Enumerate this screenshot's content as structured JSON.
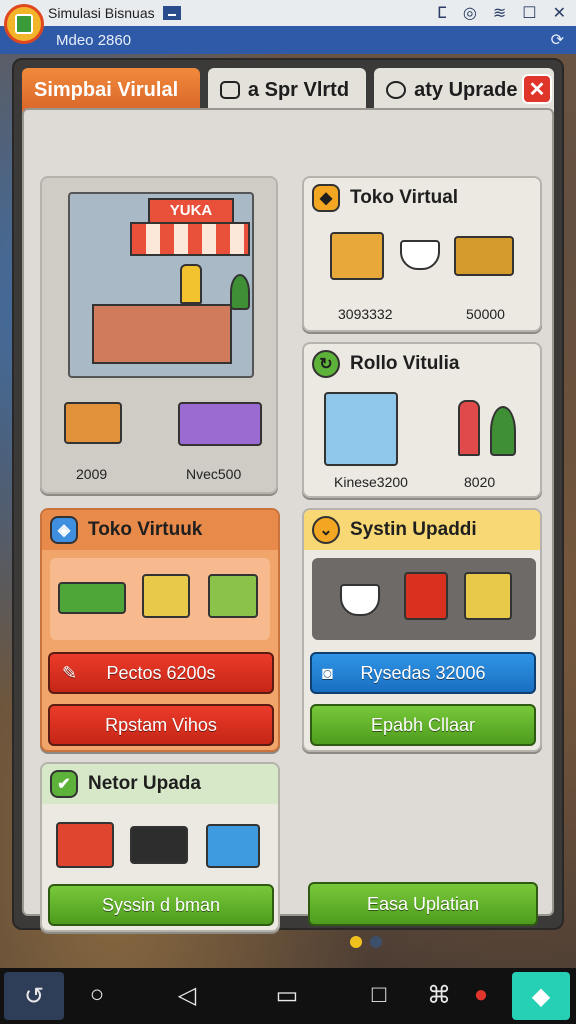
{
  "system": {
    "window_title": "Simulasi Bisnuas",
    "subtitle": "Mdeo 2860",
    "refresh_icon": "refresh-icon"
  },
  "tabs": [
    {
      "label": "Simpbai Virulal",
      "active": true
    },
    {
      "label": "a Spr Vlrtd",
      "active": false
    },
    {
      "label": "aty Uprade",
      "active": false
    }
  ],
  "close_label": "✕",
  "cards": {
    "shop_scene": {
      "sign": "YUKA",
      "left_value": "2009",
      "right_value": "Nvec500"
    },
    "toko_virtual_top": {
      "title": "Toko Virtual",
      "left_value": "3093332",
      "right_value": "50000"
    },
    "rollo_virtual": {
      "title": "Rollo Vitulia",
      "left_value": "Kinese3200",
      "right_value": "8020"
    },
    "toko_virtuk": {
      "title": "Toko Virtuuk",
      "btn_primary": "Pectos 6200s",
      "btn_secondary": "Rpstam Vihos"
    },
    "system_update": {
      "title": "Systin Upaddi",
      "btn_primary": "Rysedas 32006",
      "btn_secondary": "Epabh Cllaar"
    },
    "netor_update": {
      "title": "Netor Upada",
      "btn": "Syssin d bman"
    },
    "easa_update": {
      "btn": "Easa Uplatian"
    }
  },
  "colors": {
    "accent_orange": "#e8772f",
    "red": "#d9301f",
    "green": "#63b52c",
    "blue": "#2382d6",
    "panel": "#dedbd6"
  },
  "pager": {
    "pages": 2,
    "current": 1
  }
}
